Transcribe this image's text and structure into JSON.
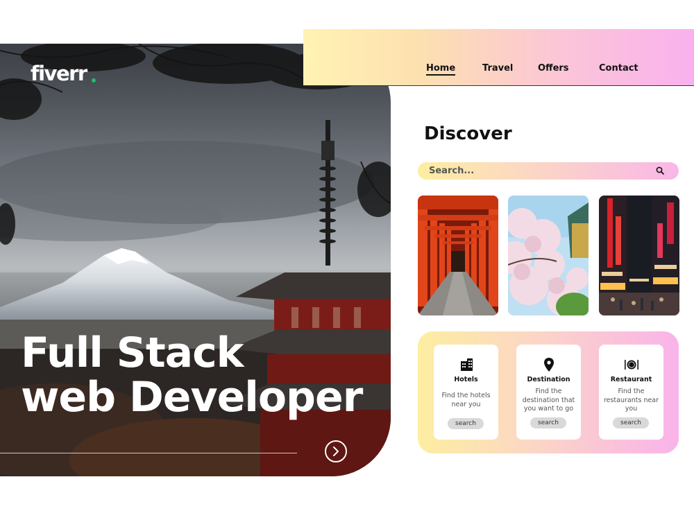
{
  "brand": {
    "logo_text": "fiverr",
    "accent": "#1dbf73"
  },
  "hero": {
    "title_line1": "Full Stack",
    "title_line2": "web Developer",
    "next_icon": "chevron-right-icon"
  },
  "nav": {
    "items": [
      {
        "label": "Home",
        "active": true
      },
      {
        "label": "Travel",
        "active": false
      },
      {
        "label": "Offers",
        "active": false
      },
      {
        "label": "Contact",
        "active": false
      }
    ]
  },
  "discover": {
    "title": "Discover",
    "search_placeholder": "Search...",
    "search_icon": "search-icon",
    "photos": [
      "torii-gates-photo",
      "cherry-blossom-photo",
      "city-neon-street-photo"
    ]
  },
  "services": [
    {
      "icon": "building-icon",
      "title": "Hotels",
      "description": "Find the hotels near you",
      "button": "search"
    },
    {
      "icon": "location-pin-icon",
      "title": "Destination",
      "description": "Find the destination that you want to go",
      "button": "search"
    },
    {
      "icon": "dining-icon",
      "title": "Restaurant",
      "description": "Find the restaurants near you",
      "button": "search"
    }
  ],
  "colors": {
    "gradient_start": "#fff3b3",
    "gradient_end": "#f9b1ee",
    "text": "#111111"
  }
}
